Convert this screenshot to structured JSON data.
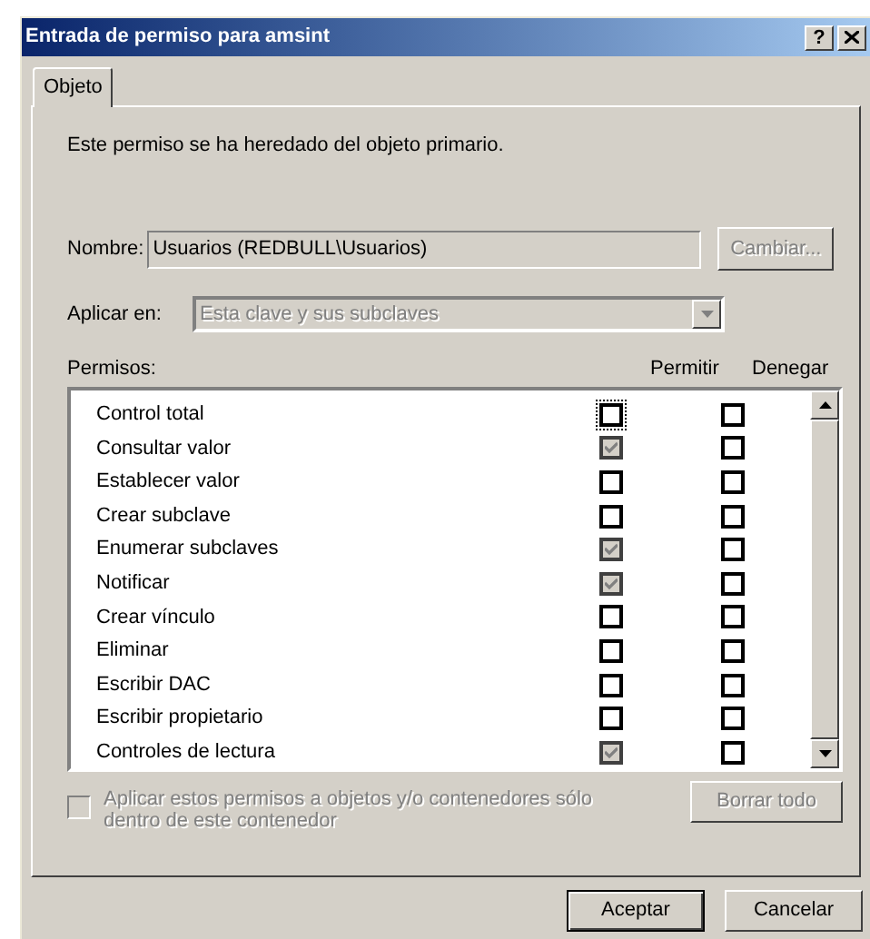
{
  "window": {
    "title": "Entrada de permiso para amsint",
    "title_buttons": [
      "?"
    ]
  },
  "tabs": [
    {
      "label": "Objeto",
      "selected": true
    }
  ],
  "inherited_note": "Este permiso se ha heredado del objeto primario.",
  "name": {
    "label": "Nombre:",
    "value": "Usuarios (REDBULL\\Usuarios)",
    "disabled": true
  },
  "change_button": {
    "label": "Cambiar...",
    "disabled": true
  },
  "apply_to": {
    "label": "Aplicar en:",
    "value": "Esta clave y sus subclaves",
    "disabled": true
  },
  "permissions": {
    "label": "Permisos:",
    "columns": [
      "Permitir",
      "Denegar"
    ],
    "rows": [
      {
        "name": "Control total",
        "allow": {
          "checked": false,
          "disabled": false,
          "focused": true
        },
        "deny": {
          "checked": false,
          "disabled": false
        }
      },
      {
        "name": "Consultar valor",
        "allow": {
          "checked": true,
          "disabled": true,
          "focused": false
        },
        "deny": {
          "checked": false,
          "disabled": false
        }
      },
      {
        "name": "Establecer valor",
        "allow": {
          "checked": false,
          "disabled": false,
          "focused": false
        },
        "deny": {
          "checked": false,
          "disabled": false
        }
      },
      {
        "name": "Crear subclave",
        "allow": {
          "checked": false,
          "disabled": false,
          "focused": false
        },
        "deny": {
          "checked": false,
          "disabled": false
        }
      },
      {
        "name": "Enumerar subclaves",
        "allow": {
          "checked": true,
          "disabled": true,
          "focused": false
        },
        "deny": {
          "checked": false,
          "disabled": false
        }
      },
      {
        "name": "Notificar",
        "allow": {
          "checked": true,
          "disabled": true,
          "focused": false
        },
        "deny": {
          "checked": false,
          "disabled": false
        }
      },
      {
        "name": "Crear vínculo",
        "allow": {
          "checked": false,
          "disabled": false,
          "focused": false
        },
        "deny": {
          "checked": false,
          "disabled": false
        }
      },
      {
        "name": "Eliminar",
        "allow": {
          "checked": false,
          "disabled": false,
          "focused": false
        },
        "deny": {
          "checked": false,
          "disabled": false
        }
      },
      {
        "name": "Escribir DAC",
        "allow": {
          "checked": false,
          "disabled": false,
          "focused": false
        },
        "deny": {
          "checked": false,
          "disabled": false
        }
      },
      {
        "name": "Escribir propietario",
        "allow": {
          "checked": false,
          "disabled": false,
          "focused": false
        },
        "deny": {
          "checked": false,
          "disabled": false
        }
      },
      {
        "name": "Controles de lectura",
        "allow": {
          "checked": true,
          "disabled": true,
          "focused": false
        },
        "deny": {
          "checked": false,
          "disabled": false
        }
      }
    ]
  },
  "apply_inside": {
    "label": "Aplicar estos permisos a objetos y/o contenedores sólo dentro de este contenedor",
    "checked": false,
    "disabled": true
  },
  "clear_button": {
    "label": "Borrar todo",
    "disabled": true
  },
  "buttons": [
    {
      "label": "Aceptar",
      "default": true
    },
    {
      "label": "Cancelar",
      "default": false
    }
  ]
}
